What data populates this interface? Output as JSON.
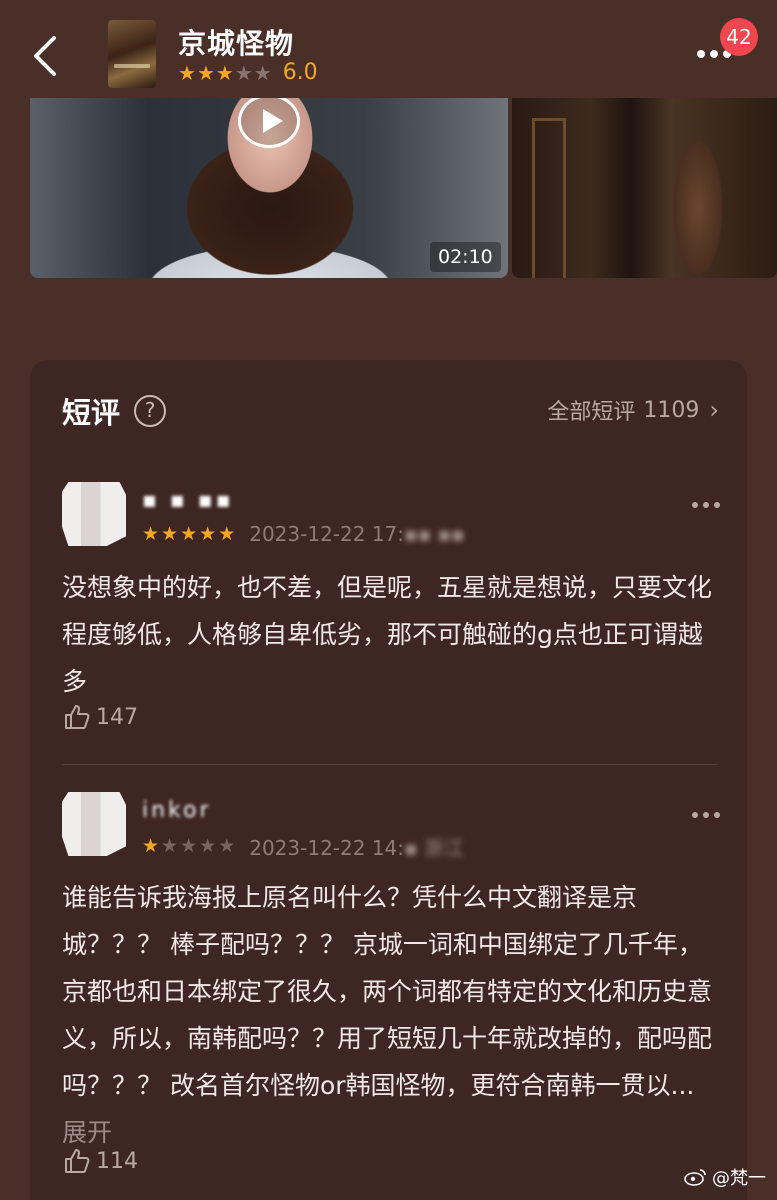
{
  "header": {
    "title": "京城怪物",
    "rating": 6.0,
    "rating_label": "6.0",
    "stars_filled": 3,
    "stars_total": 5,
    "notification_count": "42"
  },
  "media": {
    "video_duration": "02:10"
  },
  "reviews_section": {
    "title": "短评",
    "all_link_label": "全部短评",
    "all_count": "1109"
  },
  "reviews": [
    {
      "username": "▪ ▪ ▪▪",
      "stars": 5,
      "time_visible": "2023-12-22 17:",
      "time_obscured": "▪▪ ▪▪",
      "body": "没想象中的好，也不差，但是呢，五星就是想说，只要文化程度够低，人格够自卑低劣，那不可触碰的g点也正可谓越多",
      "likes": "147"
    },
    {
      "username": "inkor",
      "stars": 1,
      "time_visible": "2023-12-22 14:",
      "time_obscured": "▪ 浙江",
      "body": "谁能告诉我海报上原名叫什么？凭什么中文翻译是京城？？？ 棒子配吗？？？ 京城一词和中国绑定了几千年，京都也和日本绑定了很久，两个词都有特定的文化和历史意义，所以，南韩配吗？？用了短短几十年就改掉的，配吗配吗？？？ 改名首尔怪物or韩国怪物，更符合南韩一贯以...",
      "expand_label": "展开",
      "likes": "114"
    }
  ],
  "watermark": "@梵一",
  "colors": {
    "background": "#4a2e28",
    "card": "#3e2622",
    "accent_star": "#f5a623",
    "badge": "#f0464d"
  }
}
